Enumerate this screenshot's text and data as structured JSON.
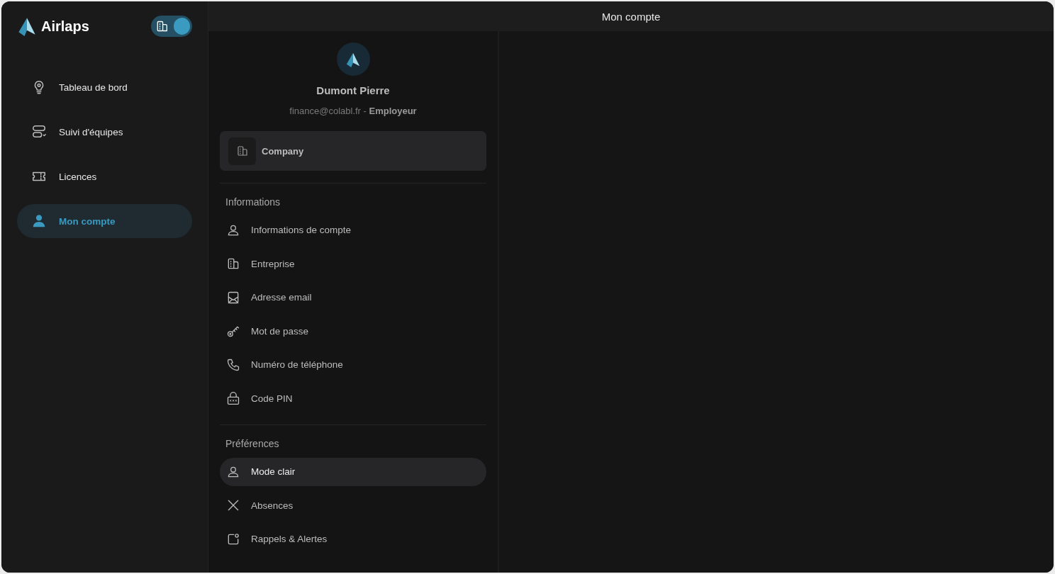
{
  "app": {
    "name": "Airlaps",
    "mode_toggle": {
      "on": true
    }
  },
  "sidebar": {
    "items": [
      {
        "label": "Tableau de bord",
        "selected": false
      },
      {
        "label": "Suivi d'équipes",
        "selected": false
      },
      {
        "label": "Licences",
        "selected": false
      },
      {
        "label": "Mon compte",
        "selected": true
      }
    ]
  },
  "header": {
    "title": "Mon compte"
  },
  "profile": {
    "name": "Dumont Pierre",
    "email": "finance@colabl.fr",
    "separator": "-",
    "role": "Employeur",
    "company": "Company"
  },
  "sections": [
    {
      "title": "Informations",
      "items": [
        {
          "label": "Informations de compte",
          "selected": false
        },
        {
          "label": "Entreprise",
          "selected": false
        },
        {
          "label": "Adresse email",
          "selected": false
        },
        {
          "label": "Mot de passe",
          "selected": false
        },
        {
          "label": "Numéro de téléphone",
          "selected": false
        },
        {
          "label": "Code PIN",
          "selected": false
        }
      ]
    },
    {
      "title": "Préférences",
      "items": [
        {
          "label": "Mode clair",
          "selected": true
        },
        {
          "label": "Absences",
          "selected": false
        },
        {
          "label": "Rappels & Alertes",
          "selected": false
        }
      ]
    }
  ]
}
